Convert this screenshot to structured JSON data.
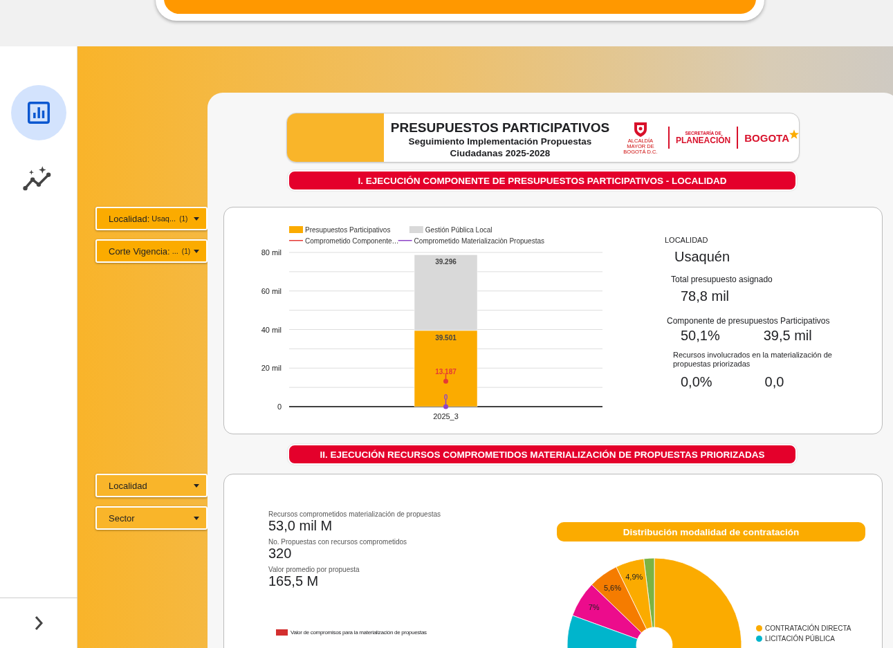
{
  "sidebar": {
    "items": [
      {
        "kind": "report",
        "selected": true
      },
      {
        "kind": "insights",
        "selected": false
      }
    ]
  },
  "filters_top": [
    {
      "label": "Localidad:",
      "value": "Usaq...",
      "count": "(1)"
    },
    {
      "label": "Corte Vigencia:",
      "value": "...",
      "count": "(1)"
    }
  ],
  "filters_bottom": [
    {
      "label": "Localidad"
    },
    {
      "label": "Sector"
    }
  ],
  "header": {
    "title": "PRESUPUESTOS PARTICIPATIVOS",
    "subtitle": "Seguimiento Implementación Propuestas Ciudadanas 2025-2028",
    "logo_caption": "ALCALDÍA MAYOR DE BOGOTÁ D.C.",
    "secretaria": "SECRETARÍA DE",
    "planeacion": "PLANEACIÓN",
    "bogota": "BOGOTA"
  },
  "section_1": {
    "title": "I. EJECUCIÓN  COMPONENTE DE PRESUPUESTOS PARTICIPATIVOS - LOCALIDAD",
    "chart_data": {
      "type": "bar",
      "stacked": true,
      "categories": [
        "2025_3"
      ],
      "series": [
        {
          "name": "Presupuestos Participativos",
          "color": "#fbab00",
          "values": [
            39.5
          ]
        },
        {
          "name": "Gestión Pública Local",
          "color": "#d9d9d9",
          "values": [
            39.3
          ]
        },
        {
          "name": "Comprometido Componente…",
          "color": "#e53935",
          "values": [
            13.2
          ],
          "type": "line",
          "marker": true
        },
        {
          "name": "Comprometido Materializaciòn Propuestas",
          "color": "#8e44c8",
          "values": [
            0
          ],
          "type": "line",
          "marker": true
        }
      ],
      "legend": "top",
      "ylim": [
        0,
        80
      ],
      "yticks": [
        {
          "value": 0,
          "label": "0"
        },
        {
          "value": 20,
          "label": "20 mil"
        },
        {
          "value": 40,
          "label": "40 mil"
        },
        {
          "value": 60,
          "label": "60 mil"
        },
        {
          "value": 80,
          "label": "80 mil"
        }
      ],
      "value_labels": [
        "39.501",
        "39.296",
        "13.187",
        "0"
      ]
    },
    "kpis": {
      "localidad_label": "LOCALIDAD",
      "localidad": "Usaquén",
      "total_label": "Total presupuesto asignado",
      "total": "78,8 mil",
      "componente_label": "Componente de presupuestos Participativos",
      "componente_pct": "50,1%",
      "componente_value": "39,5 mil",
      "recursos_label": "Recursos involucrados en la materialización de propuestas priorizadas",
      "recursos_pct": "0,0%",
      "recursos_value": "0,0"
    }
  },
  "section_2": {
    "title": "II. EJECUCIÓN  RECURSOS COMPROMETIDOS MATERIALIZACIÓN DE PROPUESTAS PRIORIZADAS",
    "kpis": [
      {
        "label": "Recursos comprometidos materialización de propuestas",
        "value": "53,0 mil M"
      },
      {
        "label": "No. Propuestas con recursos comprometidos",
        "value": "320"
      },
      {
        "label": "Valor promedio por propuesta",
        "value": "165,5 M"
      }
    ],
    "bar_legend": {
      "label": "Valor de compromisos para la materialización de propuestas",
      "color": "#d32f2f"
    },
    "pie": {
      "title": "Distribución modalidad de contratación",
      "slices": [
        {
          "color": "#fbab00"
        },
        {
          "color": "#7cb342"
        },
        {
          "color": "#fbab00",
          "label": "4,9%"
        },
        {
          "color": "#f57c00",
          "label": "5,6%"
        },
        {
          "color": "#ec0c8c",
          "label": "7%"
        },
        {
          "color": "#00b5cc"
        }
      ],
      "legend": [
        {
          "label": "CONTRATACIÓN DIRECTA",
          "color": "#fbab00"
        },
        {
          "label": "LICITACIÓN PÚBLICA",
          "color": "#00b5cc"
        }
      ]
    }
  }
}
